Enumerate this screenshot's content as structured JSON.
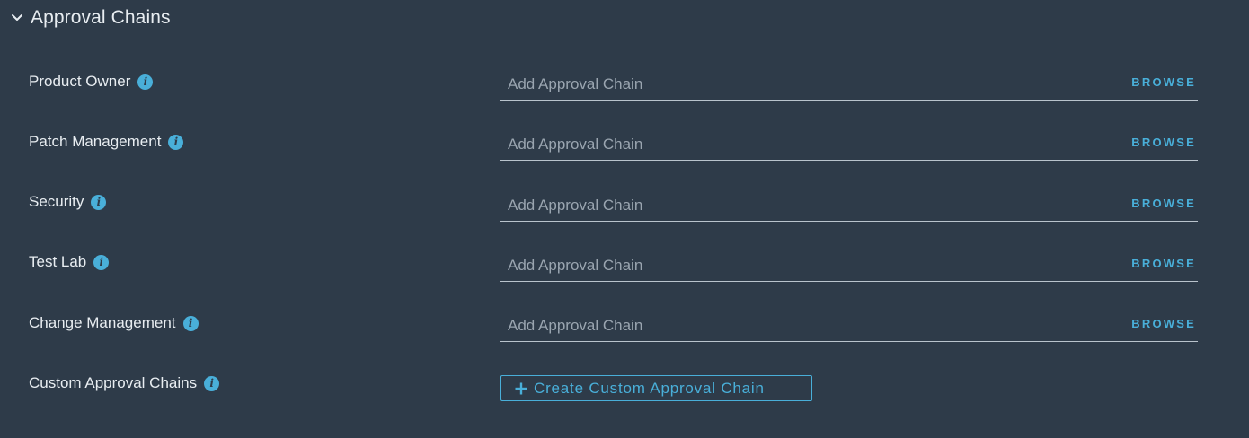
{
  "section": {
    "title": "Approval Chains",
    "expanded": true
  },
  "rows": [
    {
      "label": "Product Owner",
      "placeholder": "Add Approval Chain",
      "browse_label": "BROWSE"
    },
    {
      "label": "Patch Management",
      "placeholder": "Add Approval Chain",
      "browse_label": "BROWSE"
    },
    {
      "label": "Security",
      "placeholder": "Add Approval Chain",
      "browse_label": "BROWSE"
    },
    {
      "label": "Test Lab",
      "placeholder": "Add Approval Chain",
      "browse_label": "BROWSE"
    },
    {
      "label": "Change Management",
      "placeholder": "Add Approval Chain",
      "browse_label": "BROWSE"
    }
  ],
  "custom": {
    "label": "Custom Approval Chains",
    "button_label": "Create Custom Approval Chain"
  },
  "colors": {
    "background": "#2e3b49",
    "accent": "#49afd9",
    "text": "#e8edf1",
    "placeholder": "#9aa5b0",
    "underline": "#b9c3cc"
  },
  "icons": {
    "collapse": "chevron-down-icon",
    "info": "info-icon",
    "add": "plus-icon"
  }
}
